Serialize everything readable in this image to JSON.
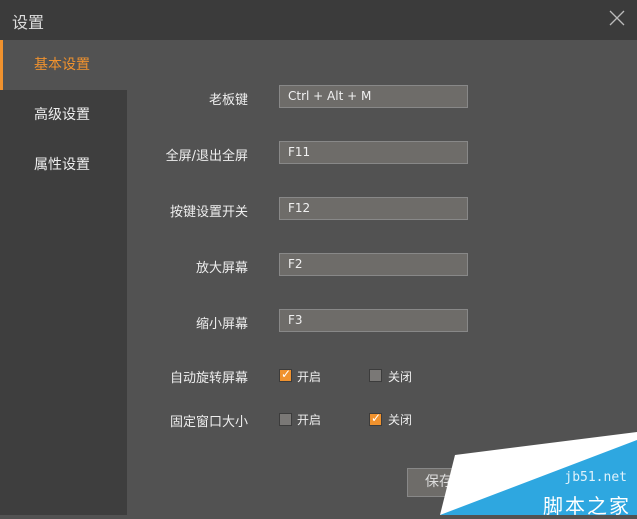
{
  "window": {
    "title": "设置"
  },
  "sidebar": {
    "items": [
      {
        "label": "基本设置",
        "active": true
      },
      {
        "label": "高级设置"
      },
      {
        "label": "属性设置"
      }
    ]
  },
  "form": {
    "boss_key": {
      "label": "老板键",
      "value": "Ctrl + Alt + M"
    },
    "fullscreen": {
      "label": "全屏/退出全屏",
      "value": "F11"
    },
    "key_settings": {
      "label": "按键设置开关",
      "value": "F12"
    },
    "zoom_in": {
      "label": "放大屏幕",
      "value": "F2"
    },
    "zoom_out": {
      "label": "缩小屏幕",
      "value": "F3"
    },
    "auto_rotate": {
      "label": "自动旋转屏幕",
      "on_label": "开启",
      "off_label": "关闭",
      "selected": "on"
    },
    "fixed_size": {
      "label": "固定窗口大小",
      "on_label": "开启",
      "off_label": "关闭",
      "selected": "off"
    }
  },
  "buttons": {
    "save": "保存"
  },
  "watermark": {
    "site": "jb51.net",
    "name": "脚本之家",
    "color": "#2ea7e0"
  }
}
